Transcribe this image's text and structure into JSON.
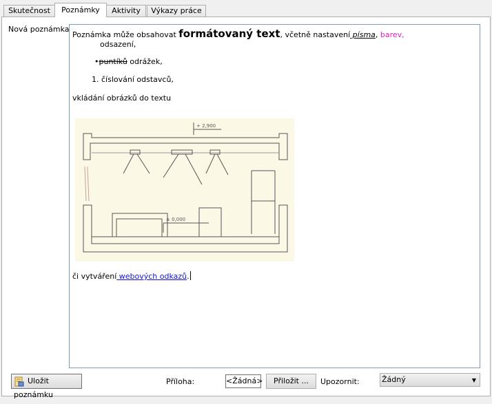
{
  "tabs": [
    "Skutečnost",
    "Poznámky",
    "Aktivity",
    "Výkazy práce"
  ],
  "active_tab": "Poznámky",
  "note_label": "Nová poznámka:",
  "editor": {
    "line1_prefix": "Poznámka může obsahovat ",
    "line1_bold": "formátovaný text",
    "line1_mid": ", včetně  nastavení",
    "line1_italic": " písma",
    "line1_comma": ",",
    "line1_pink": " barev,",
    "line2": "odsazení,",
    "bullet_strike": "puntíků",
    "bullet_rest": " odrážek,",
    "numbered_index": "1.",
    "numbered_text": "číslování odstavců,",
    "images_text": "vkládání obrázků do textu",
    "drawing_dim1": "+ 2,900",
    "drawing_dim2": "± 0,000",
    "link_prefix": "či vytváření",
    "link_text": " webových odkazů",
    "link_suffix": "."
  },
  "footer": {
    "save_button": "Uložit poznámku",
    "attachment_label": "Příloha:",
    "attachment_value": "<Žádná>",
    "attach_button": "Přiložit ...",
    "notify_label": "Upozornit:",
    "notify_value": "Žádný"
  },
  "colors": {
    "accent_pink": "#e020c0",
    "link_blue": "#1010e0",
    "editor_border": "#7a9bb5",
    "paper": "#fbf8e6"
  }
}
